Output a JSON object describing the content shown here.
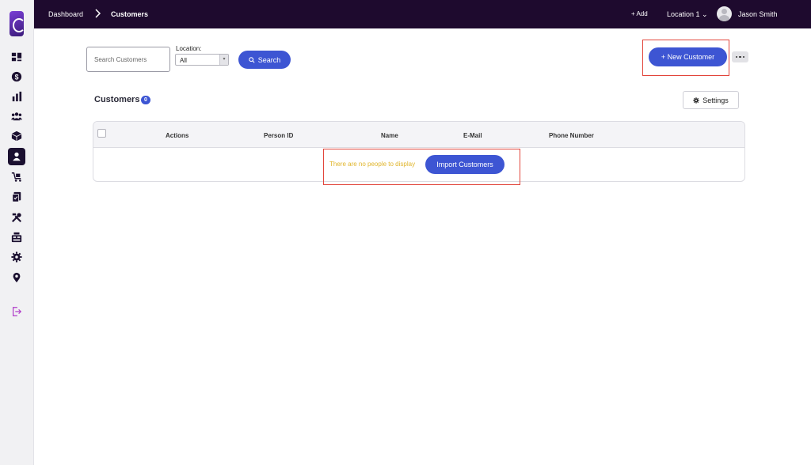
{
  "topbar": {
    "breadcrumb": [
      "Dashboard",
      "Customers"
    ],
    "add_label": "+ Add",
    "location_label": "Location 1 ⌄",
    "user_name": "Jason Smith"
  },
  "sidebar": {
    "icons": [
      "dashboard-icon",
      "dollar-icon",
      "bar-chart-icon",
      "users-icon",
      "box-icon",
      "customer-icon",
      "cart-icon",
      "clipboard-icon",
      "tools-icon",
      "register-icon",
      "gear-icon",
      "location-pin-icon",
      "logout-icon"
    ],
    "active": "customer-icon"
  },
  "search": {
    "placeholder": "Search Customers",
    "location_label": "Location:",
    "location_value": "All",
    "button_label": "Search"
  },
  "actions": {
    "new_customer_label": "+ New Customer"
  },
  "customers": {
    "title": "Customers",
    "count": "0",
    "settings_label": "Settings",
    "columns": [
      "Actions",
      "Person ID",
      "Name",
      "E-Mail",
      "Phone Number"
    ],
    "empty_text": "There are no people to display",
    "import_label": "Import Customers"
  },
  "colors": {
    "accent": "#3d55d3",
    "topbar": "#1e0a2e",
    "highlight_box": "#e2453b",
    "empty_text": "#e0b52b"
  }
}
